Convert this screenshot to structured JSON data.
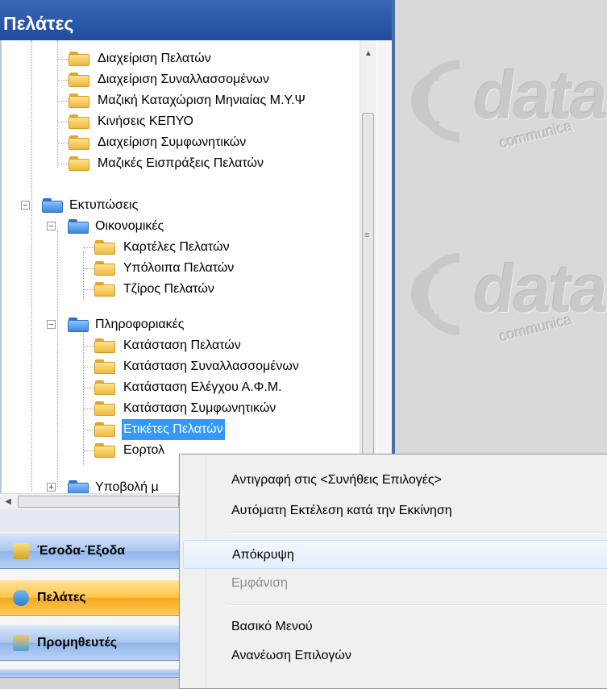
{
  "panel": {
    "title": "Πελάτες"
  },
  "tree": {
    "items": [
      {
        "label": "Διαχείριση Πελατών"
      },
      {
        "label": "Διαχείριση Συναλλασσομένων"
      },
      {
        "label": "Μαζική Καταχώριση Μηνιαίας Μ.Υ.Ψ"
      },
      {
        "label": "Κινήσεις ΚΕΠΥΟ"
      },
      {
        "label": "Διαχείριση Συμφωνητικών"
      },
      {
        "label": "Μαζικές Εισπράξεις Πελατών"
      },
      {
        "label": "Εκτυπώσεις"
      },
      {
        "label": "Οικονομικές"
      },
      {
        "label": "Καρτέλες Πελατών"
      },
      {
        "label": "Υπόλοιπα Πελατών"
      },
      {
        "label": "Τζίρος Πελατών"
      },
      {
        "label": "Πληροφοριακές"
      },
      {
        "label": "Κατάσταση Πελατών"
      },
      {
        "label": "Κατάσταση Συναλλασσομένων"
      },
      {
        "label": "Κατάσταση Ελέγχου Α.Φ.Μ."
      },
      {
        "label": "Κατάσταση Συμφωνητικών"
      },
      {
        "label": "Ετικέτες Πελατών"
      },
      {
        "label": "Εορτολ"
      },
      {
        "label": "Υποβολή μ"
      }
    ]
  },
  "nav": {
    "items": [
      {
        "label": "Έσοδα-Έξοδα"
      },
      {
        "label": "Πελάτες"
      },
      {
        "label": "Προμηθευτές"
      }
    ]
  },
  "context_menu": {
    "items": [
      {
        "label": "Αντιγραφή στις <Συνήθεις Επιλογές>"
      },
      {
        "label": "Αυτόματη Εκτέλεση κατά την Εκκίνηση"
      },
      {
        "label": "Απόκρυψη"
      },
      {
        "label": "Εμφάνιση"
      },
      {
        "label": "Βασικό Μενού"
      },
      {
        "label": "Ανανέωση Επιλογών"
      }
    ]
  },
  "watermark": {
    "brand": "data",
    "sub": "communica"
  }
}
